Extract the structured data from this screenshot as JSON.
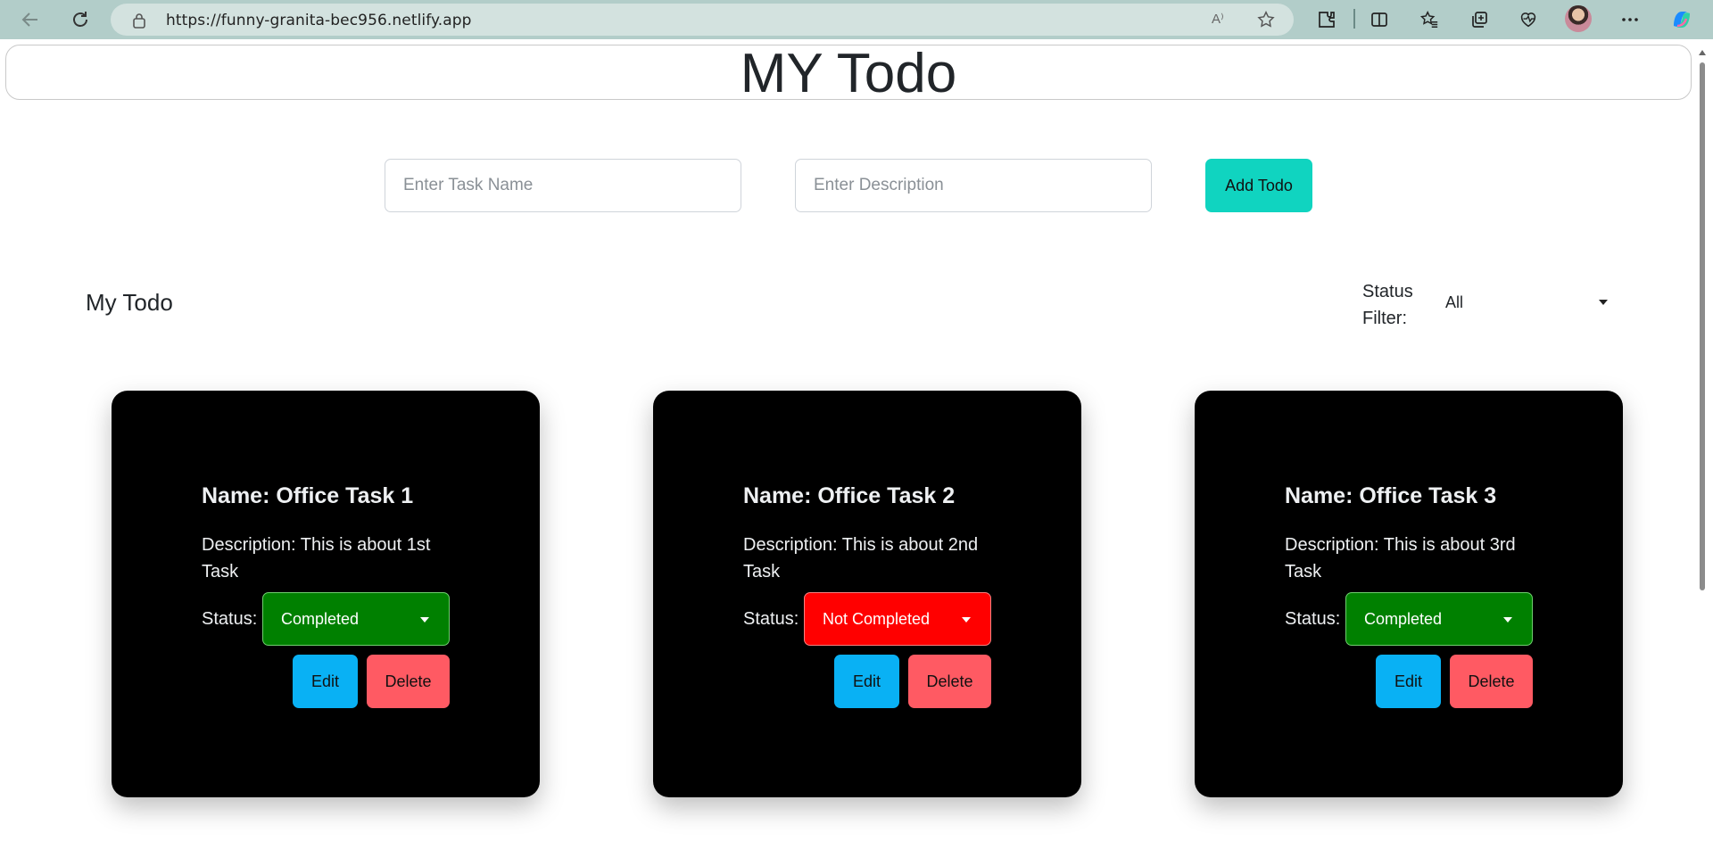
{
  "browser": {
    "url": "https://funny-granita-bec956.netlify.app",
    "read_aloud_label": "A⁾"
  },
  "header": {
    "title": "MY Todo"
  },
  "form": {
    "task_placeholder": "Enter Task Name",
    "description_placeholder": "Enter Description",
    "add_label": "Add Todo"
  },
  "section": {
    "title": "My Todo",
    "filter_label": "Status Filter:",
    "filter_value": "All"
  },
  "todos": [
    {
      "name": "Name: Office Task 1",
      "description": "Description: This is about 1st Task",
      "status_label": "Status:",
      "status": "Completed",
      "status_color": "#008000",
      "edit_label": "Edit",
      "delete_label": "Delete"
    },
    {
      "name": "Name: Office Task 2",
      "description": "Description: This is about 2nd Task",
      "status_label": "Status:",
      "status": "Not Completed",
      "status_color": "#ff0000",
      "edit_label": "Edit",
      "delete_label": "Delete"
    },
    {
      "name": "Name: Office Task 3",
      "description": "Description: This is about 3rd Task",
      "status_label": "Status:",
      "status": "Completed",
      "status_color": "#008000",
      "edit_label": "Edit",
      "delete_label": "Delete"
    }
  ],
  "colors": {
    "accent": "#10d4c0",
    "edit": "#09b1f4",
    "delete": "#ff5a63",
    "card_bg": "#000000"
  },
  "icons": [
    "back-icon",
    "refresh-icon",
    "lock-icon",
    "read-aloud-icon",
    "favorite-star-icon",
    "extensions-icon",
    "split-screen-icon",
    "favorites-icon",
    "collections-icon",
    "browser-essentials-icon",
    "profile-avatar",
    "more-icon",
    "copilot-icon"
  ]
}
